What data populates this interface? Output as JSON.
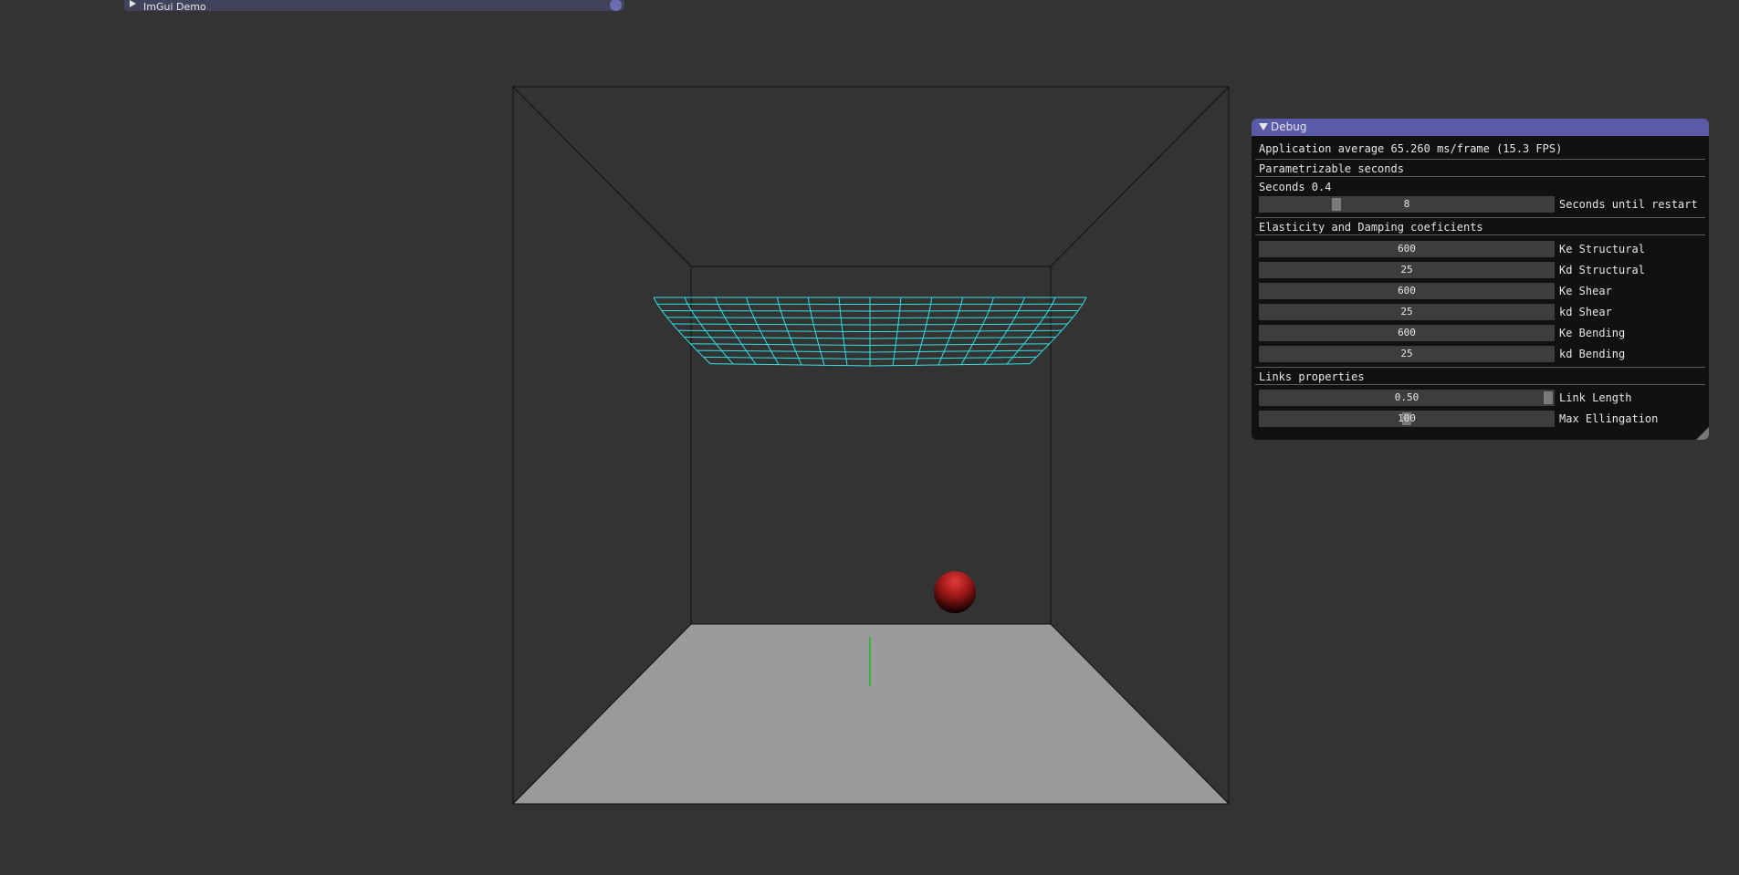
{
  "imgui_demo": {
    "title": "ImGui Demo"
  },
  "debug": {
    "title": "Debug",
    "fps_text": "Application average 65.260 ms/frame (15.3 FPS)",
    "section_seconds": "Parametrizable seconds",
    "seconds_text": "Seconds 0.4",
    "restart_slider": {
      "value": "8",
      "fraction": 0.25,
      "label": "Seconds until restart"
    },
    "section_coefficients": "Elasticity and Damping coeficients",
    "coefficients": [
      {
        "value": "600",
        "label": "Ke Structural"
      },
      {
        "value": "25",
        "label": "Kd Structural"
      },
      {
        "value": "600",
        "label": "Ke Shear"
      },
      {
        "value": "25",
        "label": "kd Shear"
      },
      {
        "value": "600",
        "label": "Ke Bending"
      },
      {
        "value": "25",
        "label": "kd Bending"
      }
    ],
    "section_links": "Links properties",
    "link_length": {
      "value": "0.50",
      "fraction": 1.0,
      "label": "Link Length"
    },
    "max_elongation": {
      "value": "100",
      "fraction": 0.5,
      "label": "Max Ellingation"
    }
  },
  "colors": {
    "background": "#333333",
    "cloth_wire": "#33e0e0",
    "floor": "#9a9a9a",
    "sphere": "#b01a1a",
    "accent": "#5a5aa8"
  }
}
